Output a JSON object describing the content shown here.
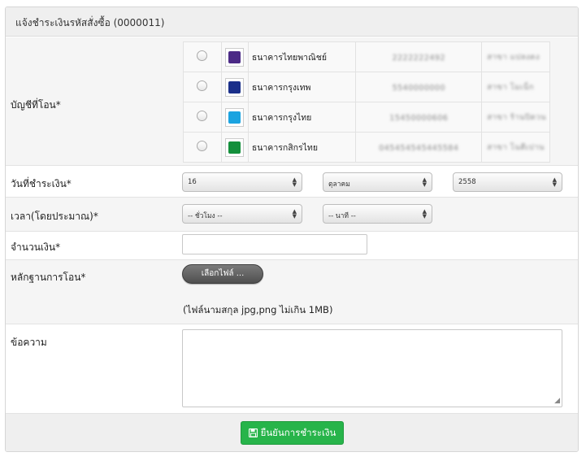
{
  "header": {
    "title": "แจ้งชำระเงินรหัสสั่งซื้อ (0000011)"
  },
  "transfer": {
    "label": "บัญชีที่โอน*",
    "banks": [
      {
        "name": "ธนาคารไทยพาณิชย์",
        "account": "2222222492",
        "owner": "สาขา แปลงดง",
        "icon": "scb-logo-icon",
        "color": "#4b2a86"
      },
      {
        "name": "ธนาคารกรุงเทพ",
        "account": "5540000000",
        "owner": "สาขา โมเน็ก",
        "icon": "bbl-logo-icon",
        "color": "#1a2f8a"
      },
      {
        "name": "ธนาคารกรุงไทย",
        "account": "15450000606",
        "owner": "สาขา ร้านปิดวน",
        "icon": "ktb-logo-icon",
        "color": "#1aa3e0"
      },
      {
        "name": "ธนาคารกสิกรไทย",
        "account": "045454545445584",
        "owner": "สาขา โนตีเปาน",
        "icon": "kbank-logo-icon",
        "color": "#138f3b"
      }
    ]
  },
  "date": {
    "label": "วันที่ชำระเงิน*",
    "day": "16",
    "month": "ตุลาคม",
    "year": "2558"
  },
  "time": {
    "label": "เวลา(โดยประมาณ)*",
    "hour": "-- ชั่วโมง --",
    "minute": "-- นาที --"
  },
  "amount": {
    "label": "จำนวนเงิน*",
    "value": ""
  },
  "evidence": {
    "label": "หลักฐานการโอน*",
    "button": "เลือกไฟล์ ...",
    "note": "(ไฟล์นามสกุล jpg,png ไม่เกิน 1MB)"
  },
  "message": {
    "label": "ข้อความ",
    "value": ""
  },
  "footer": {
    "submit": "ยืนยันการชำระเงิน"
  }
}
